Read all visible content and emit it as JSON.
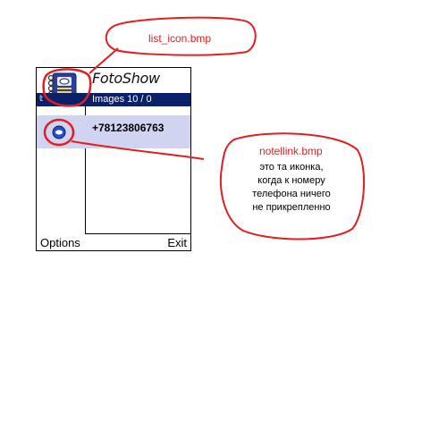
{
  "app": {
    "title": "FotoShow",
    "status": "Images 10 / 0",
    "signal_icon": "signal-icon"
  },
  "list": {
    "items": [
      {
        "text": "+78123806763",
        "icon": "notellink-icon"
      }
    ]
  },
  "softkeys": {
    "left": "Options",
    "right": "Exit"
  },
  "annotations": {
    "list_icon_label": "list_icon.bmp",
    "notellink_label": "notellink.bmp",
    "notellink_desc_lines": [
      "это та иконка,",
      "когда к номеру",
      "телефона ничего",
      "не прикрепленно"
    ]
  },
  "colors": {
    "status_bar": "#0a2169",
    "selected_row": "#d0d4f0",
    "annotation_red": "#e02020"
  }
}
